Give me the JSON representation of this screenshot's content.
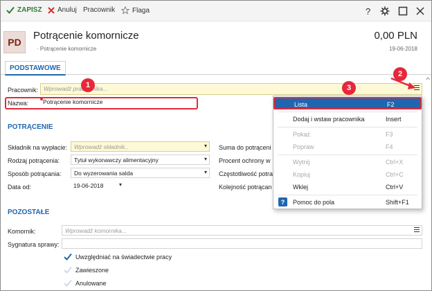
{
  "toolbar": {
    "save_label": "ZAPISZ",
    "cancel_label": "Anuluj",
    "worker_label": "Pracownik",
    "flag_label": "Flaga"
  },
  "header": {
    "avatar_text": "PD",
    "title": "Potrącenie komornicze",
    "breadcrumb": "Potrącenie komornicze",
    "amount": "0,00 PLN",
    "date": "19-06-2018"
  },
  "tabs": [
    {
      "label": "PODSTAWOWE"
    }
  ],
  "basic": {
    "worker_label": "Pracownik:",
    "worker_placeholder": "Wprowadź pracownika...",
    "name_label": "Nazwa:",
    "name_value": "Potrącenie komornicze"
  },
  "deduction": {
    "section_title": "POTRĄCENIE",
    "component_label": "Składnik na wypłacie:",
    "component_placeholder": "Wprowadź składnik..",
    "type_label": "Rodzaj potrącenia:",
    "type_value": "Tytuł wykonawczy alimentacyjny",
    "method_label": "Sposób potrącania:",
    "method_value": "Do wyzerowania salda",
    "date_from_label": "Data od:",
    "date_from_value": "19-06-2018",
    "right_labels": [
      "Suma do potrąceni",
      "Procent ochrony w",
      "Częstotliwość potra",
      "Kolejność potrącan"
    ]
  },
  "other": {
    "section_title": "POZOSTAŁE",
    "bailiff_label": "Komornik:",
    "bailiff_placeholder": "Wprowadź komornika...",
    "case_sig_label": "Sygnatura sprawy:",
    "checkboxes": [
      {
        "label": "Uwzględniać na świadectwie pracy",
        "checked": true
      },
      {
        "label": "Zawieszone",
        "checked": false
      },
      {
        "label": "Anulowane",
        "checked": false
      }
    ]
  },
  "menu": {
    "items": [
      {
        "label": "Lista",
        "shortcut": "F2",
        "state": "selected"
      },
      {
        "label": "Dodaj i wstaw pracownika",
        "shortcut": "Insert",
        "state": "enabled"
      },
      {
        "label": "Pokaż",
        "shortcut": "F3",
        "state": "disabled"
      },
      {
        "label": "Popraw",
        "shortcut": "F4",
        "state": "disabled"
      },
      {
        "label": "Wytnij",
        "shortcut": "Ctrl+X",
        "state": "disabled"
      },
      {
        "label": "Kopiuj",
        "shortcut": "Ctrl+C",
        "state": "disabled"
      },
      {
        "label": "Wklej",
        "shortcut": "Ctrl+V",
        "state": "enabled"
      },
      {
        "label": "Pomoc do pola",
        "shortcut": "Shift+F1",
        "state": "enabled",
        "icon": "help-icon"
      }
    ]
  },
  "annotations": [
    "1",
    "2",
    "3"
  ],
  "colors": {
    "accent": "#1f66b0",
    "annotation_red": "#e5283a",
    "save_green": "#2e7d32",
    "required_field": "#fdf8d6"
  }
}
